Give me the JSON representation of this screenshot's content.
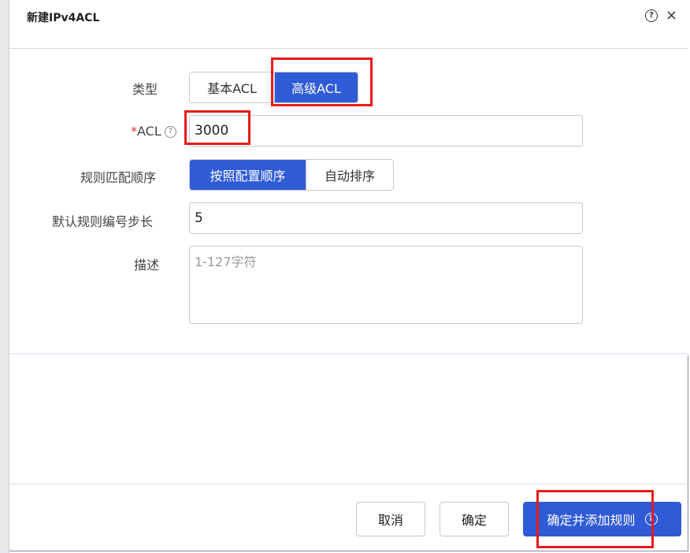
{
  "dialog": {
    "title": "新建IPv4ACL",
    "help_glyph": "?",
    "close_glyph": "×"
  },
  "form": {
    "type_label": "类型",
    "type_options": [
      "基本ACL",
      "高级ACL"
    ],
    "type_selected": "高级ACL",
    "acl_required_mark": "*",
    "acl_label": "ACL",
    "acl_value": "3000",
    "order_label": "规则匹配顺序",
    "order_options": [
      "按照配置顺序",
      "自动排序"
    ],
    "order_selected": "按照配置顺序",
    "step_label": "默认规则编号步长",
    "step_value": "5",
    "desc_label": "描述",
    "desc_placeholder": "1-127字符"
  },
  "footer": {
    "cancel_label": "取消",
    "ok_label": "确定",
    "ok_add_label": "确定并添加规则"
  },
  "colors": {
    "accent": "#2f5bd6",
    "highlight": "#e81a1a",
    "required": "#e0302e"
  }
}
